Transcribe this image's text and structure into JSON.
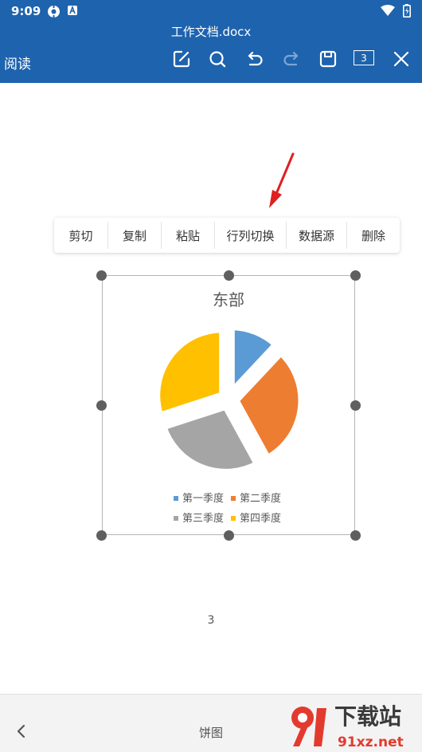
{
  "status_bar": {
    "time": "9:09"
  },
  "app_bar": {
    "document_title": "工作文档.docx",
    "mode_label": "阅读",
    "page_count": "3"
  },
  "context_menu": {
    "items": [
      {
        "label": "剪切"
      },
      {
        "label": "复制"
      },
      {
        "label": "粘贴"
      },
      {
        "label": "行列切换"
      },
      {
        "label": "数据源"
      },
      {
        "label": "删除"
      }
    ]
  },
  "chart_data": {
    "type": "pie",
    "title": "东部",
    "categories": [
      "第一季度",
      "第二季度",
      "第三季度",
      "第四季度"
    ],
    "values": [
      12,
      30,
      28,
      30
    ],
    "colors": [
      "#5b9bd5",
      "#ed7d31",
      "#a5a5a5",
      "#ffc000"
    ],
    "exploded": true,
    "legend_position": "bottom"
  },
  "page": {
    "number": "3"
  },
  "bottom_bar": {
    "title": "饼图"
  },
  "watermark": {
    "text_top": "下载站",
    "text_bottom": "91xz.net"
  },
  "colors": {
    "app_bar": "#1e63ad",
    "annotation_arrow": "#e02020"
  }
}
